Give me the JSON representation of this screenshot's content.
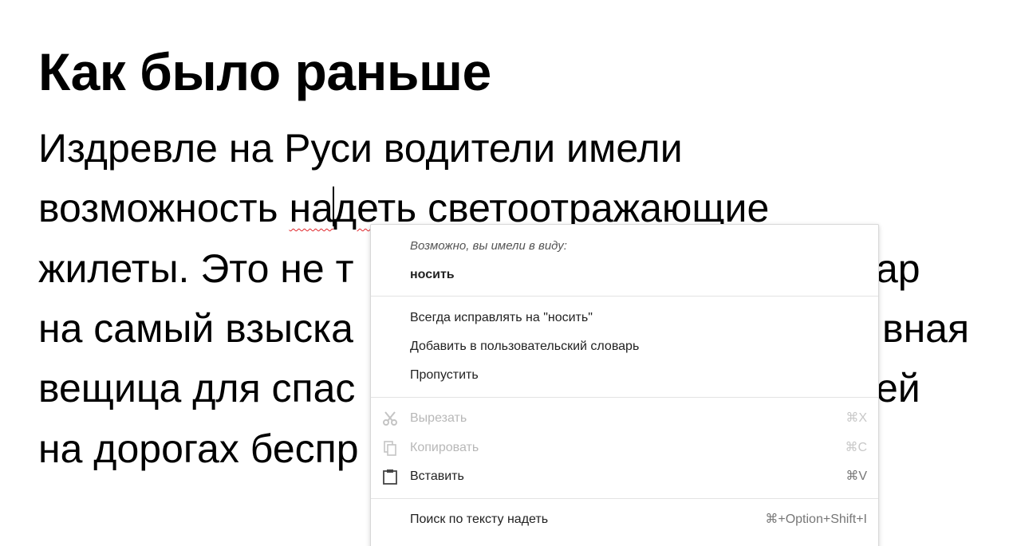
{
  "slide": {
    "title": "Как было раньше",
    "lines": {
      "l1": "Издревле на Руси водители имели",
      "l2_before": "возможность ",
      "l2_word_a": "на",
      "l2_word_b": "деть",
      "l2_after": " светоотражающие",
      "l3": "жилеты. Это не т",
      "l3_tail": "ар",
      "l4": "на самый взыска",
      "l4_tail": "вная",
      "l5": "вещица для спас",
      "l5_tail": "ей",
      "l6": "на дорогах беспр"
    }
  },
  "context_menu": {
    "header": "Возможно, вы имели в виду:",
    "suggestion": "носить",
    "always_correct": "Всегда исправлять на \"носить\"",
    "add_to_dictionary": "Добавить в пользовательский словарь",
    "skip": "Пропустить",
    "cut": {
      "label": "Вырезать",
      "shortcut": "⌘X",
      "icon": "scissors-icon"
    },
    "copy": {
      "label": "Копировать",
      "shortcut": "⌘C",
      "icon": "copy-icon"
    },
    "paste": {
      "label": "Вставить",
      "shortcut": "⌘V",
      "icon": "clipboard-icon"
    },
    "search": {
      "label": "Поиск по тексту надеть",
      "shortcut": "⌘+Option+Shift+I"
    }
  },
  "colors": {
    "spellcheck_underline": "#e0262b",
    "menu_border": "#d8d8d8",
    "disabled_text": "#b8b8b8"
  }
}
